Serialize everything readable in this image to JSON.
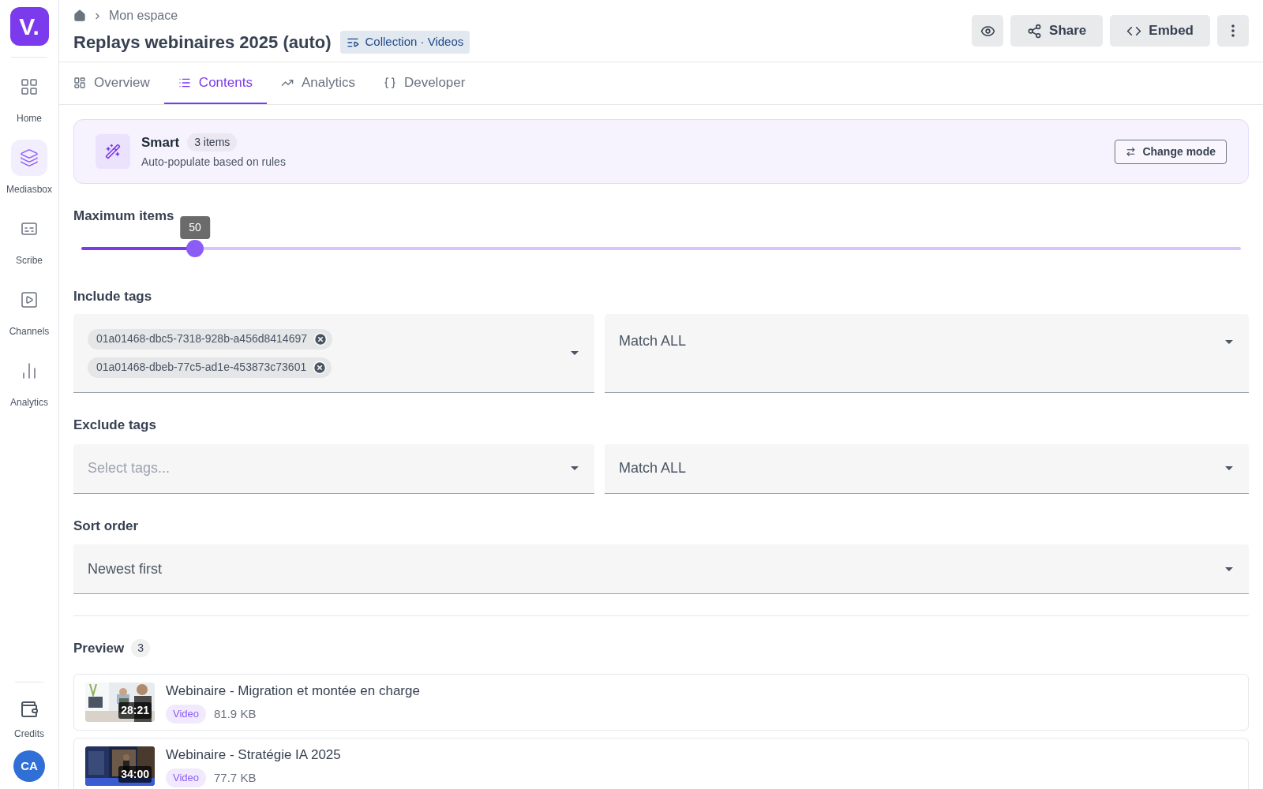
{
  "sidebar": {
    "logo": "V.",
    "items": [
      {
        "label": "Home",
        "selected": false
      },
      {
        "label": "Mediasbox",
        "selected": true
      },
      {
        "label": "Scribe",
        "selected": false
      },
      {
        "label": "Channels",
        "selected": false
      },
      {
        "label": "Analytics",
        "selected": false
      }
    ],
    "credits": {
      "label": "Credits"
    },
    "avatar": "CA"
  },
  "header": {
    "breadcrumb": [
      "Mon espace"
    ],
    "title": "Replays webinaires 2025 (auto)",
    "badge": "Collection · Videos",
    "actions": [
      {
        "kind": "icon"
      },
      {
        "kind": "text",
        "label": "Share"
      },
      {
        "kind": "text",
        "label": "Embed"
      },
      {
        "kind": "icon"
      }
    ]
  },
  "tabs": [
    {
      "label": "Overview",
      "selected": false
    },
    {
      "label": "Contents",
      "selected": true
    },
    {
      "label": "Analytics",
      "selected": false
    },
    {
      "label": "Developer",
      "selected": false
    }
  ],
  "mode": {
    "title": "Smart",
    "count": "3 items",
    "description": "Auto-populate based on rules",
    "button": "Change mode"
  },
  "max_items": {
    "label": "Maximum items",
    "value": "50",
    "level": 0.098
  },
  "include": {
    "label": "Include tags",
    "tags": [
      "01a01468-dbc5-7318-928b-a456d8414697",
      "01a01468-dbeb-77c5-ad1e-453873c73601"
    ],
    "match": "Match ALL"
  },
  "exclude": {
    "label": "Exclude tags",
    "placeholder": "Select tags...",
    "match": "Match ALL"
  },
  "sort": {
    "label": "Sort order",
    "value": "Newest first"
  },
  "preview": {
    "label": "Preview",
    "count": "3",
    "items": [
      {
        "title": "Webinaire - Migration et montée en charge",
        "duration": "28:21",
        "type": "Video",
        "size": "81.9 KB"
      },
      {
        "title": "Webinaire - Stratégie IA 2025",
        "duration": "34:00",
        "type": "Video",
        "size": "77.7 KB"
      }
    ]
  }
}
